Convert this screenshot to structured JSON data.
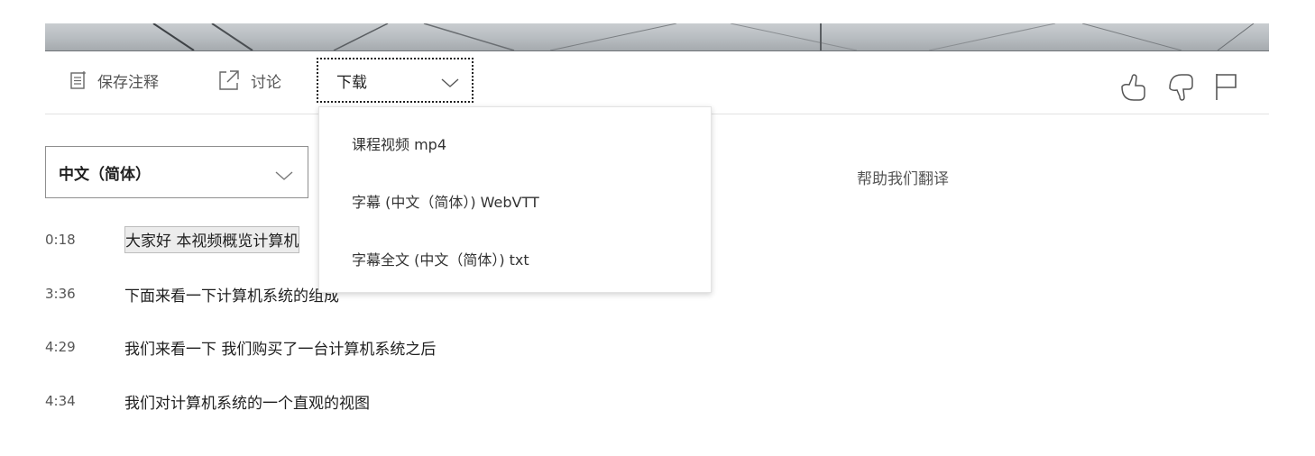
{
  "toolbar": {
    "save_notes_label": "保存注释",
    "discuss_label": "讨论",
    "download_label": "下载"
  },
  "download_menu": {
    "items": [
      {
        "label": "课程视频  mp4"
      },
      {
        "label": "字幕 (中文（简体）) WebVTT"
      },
      {
        "label": "字幕全文 (中文（简体）) txt"
      }
    ]
  },
  "transcript": {
    "language_selected": "中文（简体）",
    "help_translate": "帮助我们翻译",
    "lines": [
      {
        "time": "0:18",
        "text": "大家好 本视频概览计算机"
      },
      {
        "time": "3:36",
        "text": "下面来看一下计算机系统的组成"
      },
      {
        "time": "4:29",
        "text": "我们来看一下 我们购买了一台计算机系统之后"
      },
      {
        "time": "4:34",
        "text": "我们对计算机系统的一个直观的视图"
      }
    ]
  },
  "icons": {
    "save_notes": "notes-icon",
    "discuss": "external-link-icon",
    "download_chevron": "chevron-down-icon",
    "like": "thumbs-up-icon",
    "dislike": "thumbs-down-icon",
    "flag": "flag-icon"
  }
}
